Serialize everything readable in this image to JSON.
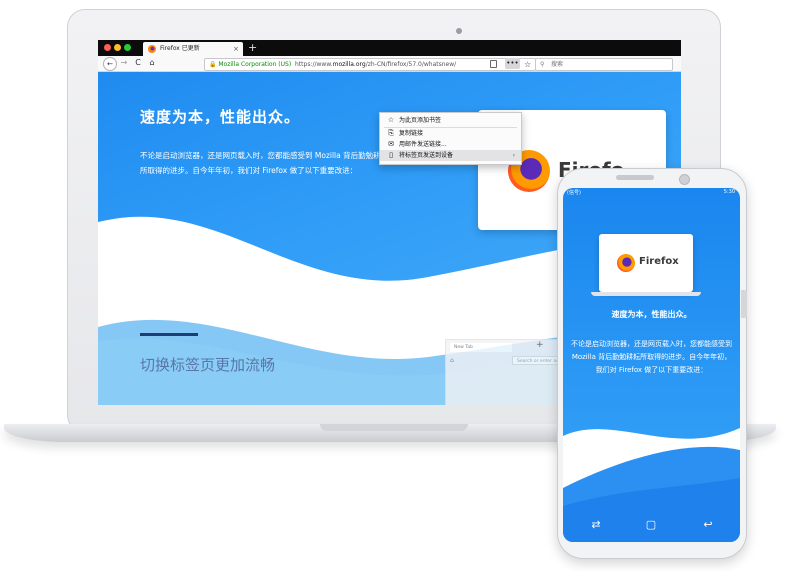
{
  "browser": {
    "tab_title": "Firefox 已更新",
    "tab_close": "×",
    "new_tab": "+",
    "nav": {
      "back": "←",
      "forward": "→",
      "reload": "C",
      "home": "⌂"
    },
    "identity": "🔒 Mozilla Corporation (US)",
    "url_prefix": "https://www.",
    "url_domain": "mozilla.org",
    "url_path": "/zh-CN/firefox/57.0/whatsnew/",
    "more": "•••",
    "star": "☆",
    "search_icon": "⚲",
    "search_placeholder": "搜索"
  },
  "menu": {
    "items": [
      {
        "icon": "☆",
        "label": "为此页添加书签",
        "arrow": ""
      },
      {
        "icon": "⎘",
        "label": "复制链接",
        "arrow": ""
      },
      {
        "icon": "✉",
        "label": "用邮件发送链接...",
        "arrow": ""
      },
      {
        "icon": "▯",
        "label": "将标签页发送到设备",
        "arrow": "›"
      }
    ]
  },
  "page": {
    "headline": "速度为本，性能出众。",
    "intro": "不论是启动浏览器，还是网页载入时，您都能感受到 Mozilla 背后勤勉耕耘所取得的进步。自今年年初，我们对 Firefox 做了以下重要改进：",
    "promo_word": "Firefo",
    "section_title": "切换标签页更加流畅",
    "mini_tab": "New Tab",
    "mini_plus": "+",
    "mini_home": "⌂",
    "mini_search": "Search or enter address"
  },
  "phone": {
    "status_left": "(信号)",
    "status_right": "5:30",
    "card_word": "Firefox",
    "headline": "速度为本，性能出众。",
    "intro": "不论是启动浏览器，还是网页载入时，您都能感受到 Mozilla 背后勤勉耕耘所取得的进步。自今年年初，我们对 Firefox 做了以下重要改进：",
    "nav_recent": "⇄",
    "nav_home": "▢",
    "nav_back": "↩"
  },
  "colors": {
    "page_blue": "#2f9cf7",
    "accent_dark": "#1d3d73",
    "tabstrip": "#0c0c0d",
    "secure_green": "#058b00"
  }
}
